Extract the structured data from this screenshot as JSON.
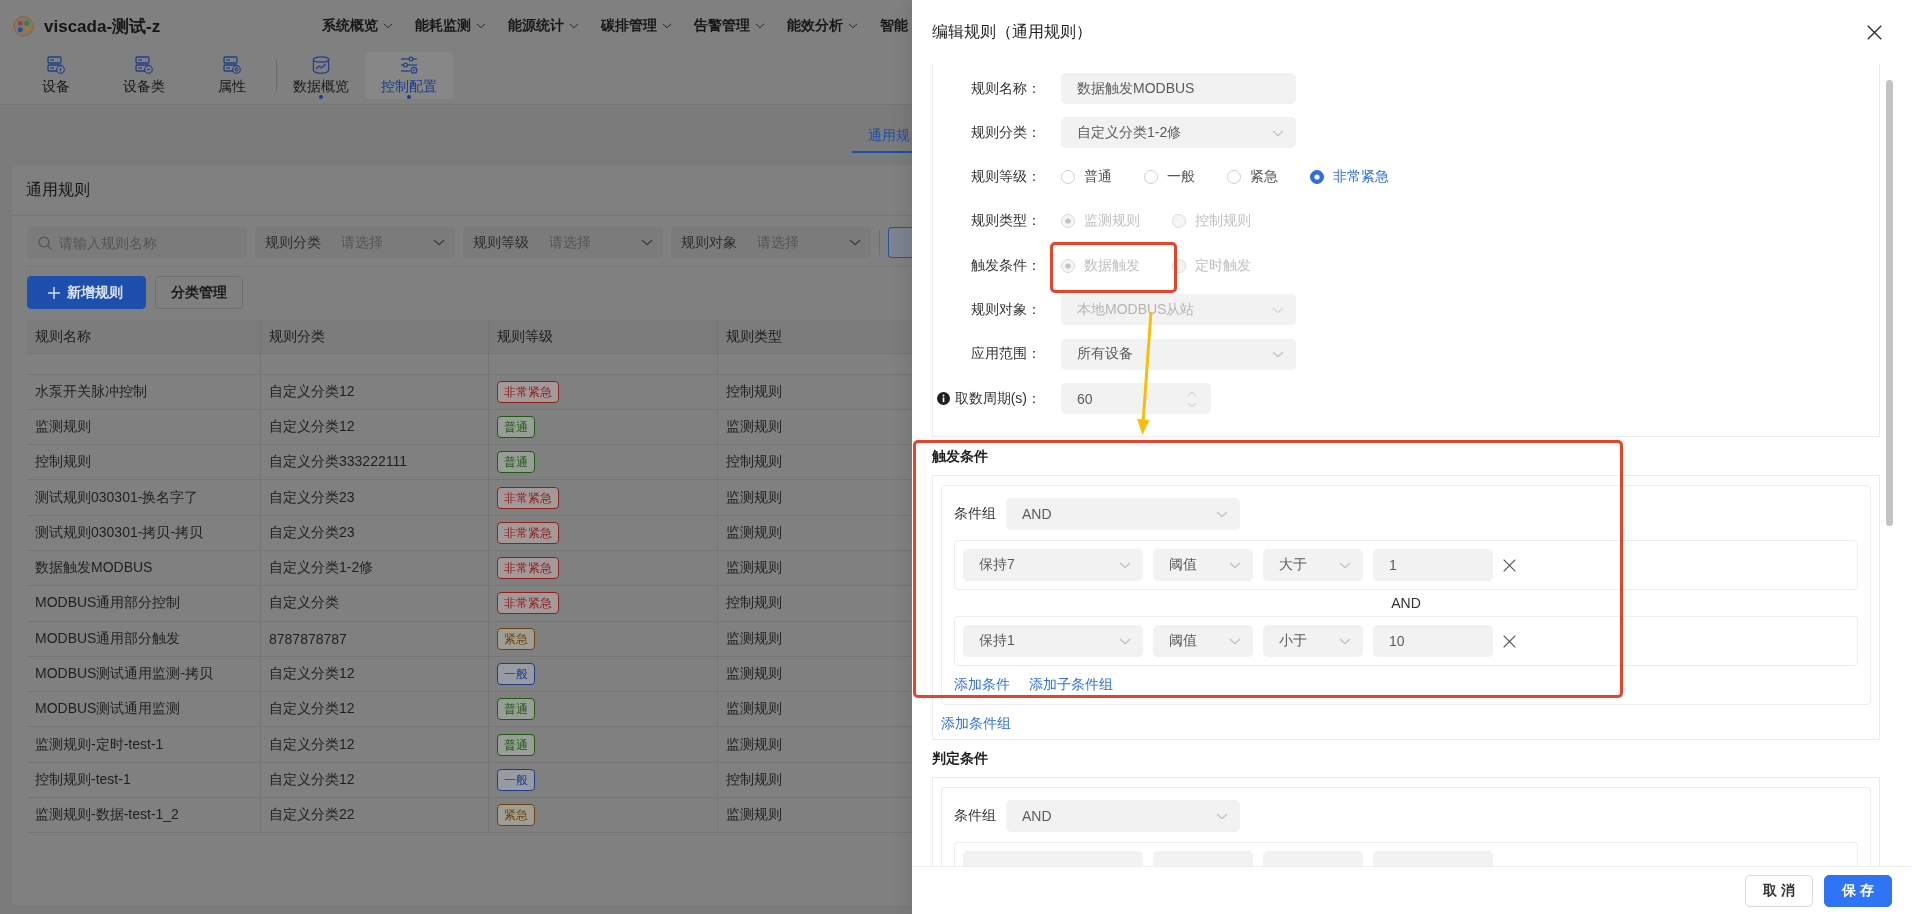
{
  "app": {
    "name": "viscada-测试-z",
    "nav": [
      {
        "label": "系统概览",
        "menu": true
      },
      {
        "label": "能耗监测",
        "menu": true
      },
      {
        "label": "能源统计",
        "menu": true
      },
      {
        "label": "碳排管理",
        "menu": true
      },
      {
        "label": "告警管理",
        "menu": true
      },
      {
        "label": "能效分析",
        "menu": true
      },
      {
        "label": "智能",
        "menu": false
      }
    ]
  },
  "toolbar": {
    "groups": [
      {
        "items": [
          {
            "label": "设备",
            "selected": false,
            "dot": false
          },
          {
            "label": "设备类",
            "selected": false,
            "dot": false
          },
          {
            "label": "属性",
            "selected": false,
            "dot": false
          }
        ]
      },
      {
        "items": [
          {
            "label": "数据概览",
            "selected": false,
            "dot": true
          },
          {
            "label": "控制配置",
            "selected": true,
            "dot": true
          }
        ]
      }
    ]
  },
  "tabs": [
    {
      "label": "通用规",
      "selected": true
    }
  ],
  "card": {
    "title": "通用规则",
    "search": {
      "placeholder": "请输入规则名称"
    },
    "filters": [
      {
        "label": "规则分类",
        "placeholder": "请选择"
      },
      {
        "label": "规则等级",
        "placeholder": "请选择"
      },
      {
        "label": "规则对象",
        "placeholder": "请选择"
      }
    ],
    "buttons": [
      {
        "label": "新增规则",
        "kind": "primary"
      },
      {
        "label": "分类管理",
        "kind": "default"
      }
    ],
    "table": {
      "columns": [
        "规则名称",
        "规则分类",
        "规则等级",
        "规则类型"
      ],
      "rows": [
        {
          "name": "水泵开关脉冲控制",
          "category": "自定义分类12",
          "grade": {
            "text": "非常紧急",
            "color": "#8e2020"
          },
          "type": "控制规则"
        },
        {
          "name": "监测规则",
          "category": "自定义分类12",
          "grade": {
            "text": "普通",
            "color": "#1e5a12"
          },
          "type": "监测规则"
        },
        {
          "name": "控制规则",
          "category": "自定义分类333222111",
          "grade": {
            "text": "普通",
            "color": "#1e5a12"
          },
          "type": "控制规则"
        },
        {
          "name": "测试规则030301-换名字了",
          "category": "自定义分类23",
          "grade": {
            "text": "非常紧急",
            "color": "#8e2020"
          },
          "type": "监测规则"
        },
        {
          "name": "测试规则030301-拷贝-拷贝",
          "category": "自定义分类23",
          "grade": {
            "text": "非常紧急",
            "color": "#8e2020"
          },
          "type": "监测规则"
        },
        {
          "name": "数据触发MODBUS",
          "category": "自定义分类1-2修",
          "grade": {
            "text": "非常紧急",
            "color": "#8e2020"
          },
          "type": "监测规则"
        },
        {
          "name": "MODBUS通用部分控制",
          "category": "自定义分类",
          "grade": {
            "text": "非常紧急",
            "color": "#8e2020"
          },
          "type": "控制规则"
        },
        {
          "name": "MODBUS通用部分触发",
          "category": "8787878787",
          "grade": {
            "text": "紧急",
            "color": "#6e4408"
          },
          "type": "监测规则"
        },
        {
          "name": "MODBUS测试通用监测-拷贝",
          "category": "自定义分类12",
          "grade": {
            "text": "一般",
            "color": "#1d3c86"
          },
          "type": "监测规则"
        },
        {
          "name": "MODBUS测试通用监测",
          "category": "自定义分类12",
          "grade": {
            "text": "普通",
            "color": "#1e5a12"
          },
          "type": "监测规则"
        },
        {
          "name": "监测规则-定时-test-1",
          "category": "自定义分类12",
          "grade": {
            "text": "普通",
            "color": "#1e5a12"
          },
          "type": "监测规则"
        },
        {
          "name": "控制规则-test-1",
          "category": "自定义分类12",
          "grade": {
            "text": "一般",
            "color": "#1d3c86"
          },
          "type": "控制规则"
        },
        {
          "name": "监测规则-数据-test-1_2",
          "category": "自定义分类22",
          "grade": {
            "text": "紧急",
            "color": "#6e4408"
          },
          "type": "监测规则"
        }
      ]
    }
  },
  "drawer": {
    "title": "编辑规则（通用规则）",
    "form": [
      {
        "kind": "input",
        "label": "规则名称：",
        "value": "数据触发MODBUS",
        "disabled": false
      },
      {
        "kind": "select",
        "label": "规则分类：",
        "value": "自定义分类1-2修",
        "disabled": false
      },
      {
        "kind": "radio",
        "label": "规则等级：",
        "disabled": false,
        "options": [
          {
            "label": "普通",
            "selected": false
          },
          {
            "label": "一般",
            "selected": false
          },
          {
            "label": "紧急",
            "selected": false
          },
          {
            "label": "非常紧急",
            "selected": true
          }
        ]
      },
      {
        "kind": "radio",
        "label": "规则类型：",
        "disabled": true,
        "options": [
          {
            "label": "监测规则",
            "selected": true
          },
          {
            "label": "控制规则",
            "selected": false
          }
        ]
      },
      {
        "kind": "radio",
        "label": "触发条件：",
        "disabled": true,
        "options": [
          {
            "label": "数据触发",
            "selected": true
          },
          {
            "label": "定时触发",
            "selected": false
          }
        ]
      },
      {
        "kind": "select",
        "label": "规则对象：",
        "value": "本地MODBUS从站",
        "disabled": true
      },
      {
        "kind": "select",
        "label": "应用范围：",
        "value": "所有设备",
        "disabled": false
      },
      {
        "kind": "number",
        "label": "取数周期(s)：",
        "value": "60",
        "disabled": false,
        "info": true
      }
    ],
    "sections": [
      {
        "title": "触发条件",
        "groups": [
          {
            "label": "条件组",
            "operator": "AND",
            "conditions": [
              {
                "point": "保持7",
                "mode": "阈值",
                "compare": "大于",
                "value": "1",
                "cut": false
              },
              {
                "point": "保持1",
                "mode": "阈值",
                "compare": "小于",
                "value": "10",
                "cut": false
              }
            ],
            "joiner": "AND",
            "links": [
              "添加条件",
              "添加子条件组"
            ]
          }
        ],
        "add_group": "添加条件组"
      },
      {
        "title": "判定条件",
        "groups": [
          {
            "label": "条件组",
            "operator": "AND",
            "conditions": [
              {
                "cut": true
              }
            ]
          }
        ]
      }
    ],
    "footer": [
      {
        "label": "取消",
        "kind": "default"
      },
      {
        "label": "保存",
        "kind": "primary"
      }
    ]
  },
  "annotations": [
    {
      "kind": "frame",
      "color": "#e9412a"
    },
    {
      "kind": "arrow",
      "color": "#f6bf0b"
    },
    {
      "kind": "frame",
      "color": "#e9412a"
    }
  ]
}
